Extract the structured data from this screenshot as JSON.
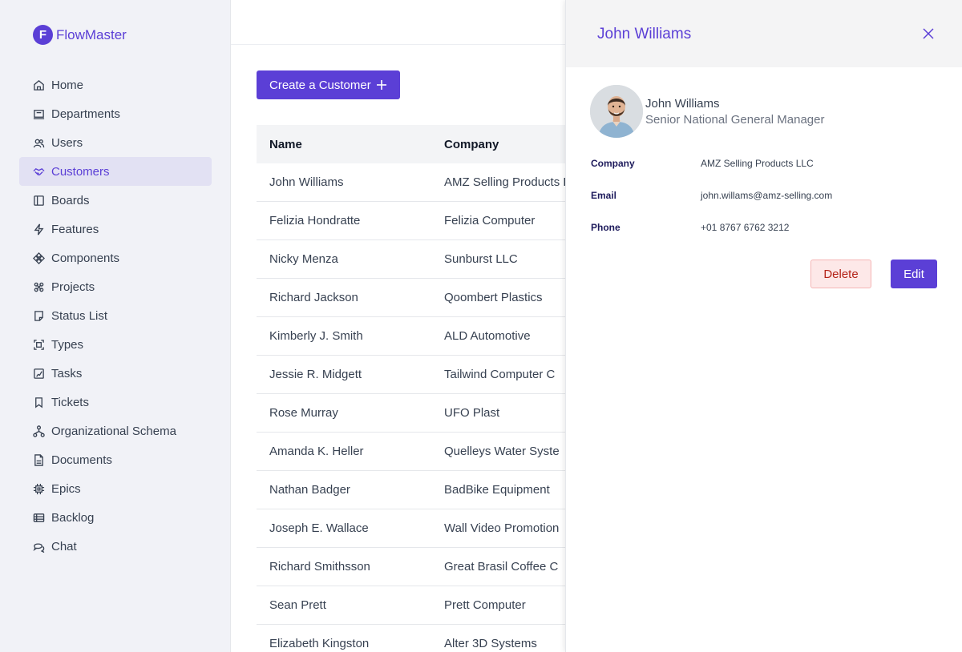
{
  "brand": {
    "logo_letter": "F",
    "name": "FlowMaster"
  },
  "sidebar": {
    "items": [
      {
        "label": "Home",
        "icon": "home-icon"
      },
      {
        "label": "Departments",
        "icon": "building-icon"
      },
      {
        "label": "Users",
        "icon": "users-icon"
      },
      {
        "label": "Customers",
        "icon": "handshake-icon",
        "active": true
      },
      {
        "label": "Boards",
        "icon": "board-icon"
      },
      {
        "label": "Features",
        "icon": "bolt-icon"
      },
      {
        "label": "Components",
        "icon": "components-icon"
      },
      {
        "label": "Projects",
        "icon": "projects-icon"
      },
      {
        "label": "Status List",
        "icon": "status-icon"
      },
      {
        "label": "Types",
        "icon": "types-icon"
      },
      {
        "label": "Tasks",
        "icon": "tasks-icon"
      },
      {
        "label": "Tickets",
        "icon": "bookmark-icon"
      },
      {
        "label": "Organizational Schema",
        "icon": "schema-icon"
      },
      {
        "label": "Documents",
        "icon": "document-icon"
      },
      {
        "label": "Epics",
        "icon": "chip-icon"
      },
      {
        "label": "Backlog",
        "icon": "backlog-icon"
      },
      {
        "label": "Chat",
        "icon": "chat-icon"
      }
    ]
  },
  "main": {
    "create_button": "Create a Customer",
    "table": {
      "headers": [
        "Name",
        "Company"
      ],
      "rows": [
        [
          "John Williams",
          "AMZ Selling Products LLC"
        ],
        [
          "Felizia Hondratte",
          "Felizia Computer"
        ],
        [
          "Nicky Menza",
          "Sunburst LLC"
        ],
        [
          "Richard Jackson",
          "Qoombert Plastics"
        ],
        [
          "Kimberly J. Smith",
          "ALD Automotive"
        ],
        [
          "Jessie R. Midgett",
          "Tailwind Computer C"
        ],
        [
          "Rose Murray",
          "UFO Plast"
        ],
        [
          "Amanda K. Heller",
          "Quelleys Water Syste"
        ],
        [
          "Nathan Badger",
          "BadBike Equipment"
        ],
        [
          "Joseph E. Wallace",
          "Wall Video Promotion"
        ],
        [
          "Richard Smithsson",
          "Great Brasil Coffee C"
        ],
        [
          "Sean Prett",
          "Prett Computer"
        ],
        [
          "Elizabeth Kingston",
          "Alter 3D Systems"
        ]
      ]
    }
  },
  "drawer": {
    "title": "John Williams",
    "name": "John Williams",
    "role": "Senior National General Manager",
    "fields": [
      {
        "label": "Company",
        "value": "AMZ Selling Products LLC"
      },
      {
        "label": "Email",
        "value": "john.willams@amz-selling.com"
      },
      {
        "label": "Phone",
        "value": "+01 8767 6762 3212"
      }
    ],
    "delete_label": "Delete",
    "edit_label": "Edit"
  },
  "colors": {
    "accent": "#5b3fd6",
    "active_bg": "#e2e1f3",
    "sidebar_bg": "#f1f2f7",
    "delete_bg": "#fde8e8",
    "delete_text": "#b42318"
  }
}
